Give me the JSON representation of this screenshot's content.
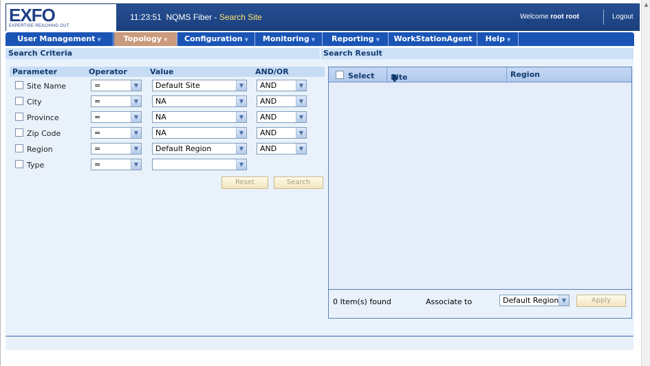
{
  "header": {
    "logo": "EXFO",
    "tagline": "EXPERTISE REACHING OUT",
    "time": "11:23:51",
    "app_name": "NQMS Fiber",
    "separator": "-",
    "page_name": "Search Site",
    "welcome_prefix": "Welcome",
    "user": "root root",
    "logout": "Logout"
  },
  "menu": {
    "items": [
      {
        "label": "User Management"
      },
      {
        "label": "Topology"
      },
      {
        "label": "Configuration"
      },
      {
        "label": "Monitoring"
      },
      {
        "label": "Reporting"
      },
      {
        "label": "WorkStationAgent"
      },
      {
        "label": "Help"
      }
    ],
    "active": "Topology",
    "colors": {
      "bar": "#1a55b6",
      "active": "#c99a7c"
    }
  },
  "criteria": {
    "title": "Search Criteria",
    "columns": [
      "Parameter",
      "Operator",
      "Value",
      "AND/OR"
    ],
    "rows": [
      {
        "param": "Site Name",
        "operator": "=",
        "value": "Default Site",
        "andor": "AND"
      },
      {
        "param": "City",
        "operator": "=",
        "value": "NA",
        "andor": "AND"
      },
      {
        "param": "Province",
        "operator": "=",
        "value": "NA",
        "andor": "AND"
      },
      {
        "param": "Zip Code",
        "operator": "=",
        "value": "NA",
        "andor": "AND"
      },
      {
        "param": "Region",
        "operator": "=",
        "value": "Default Region",
        "andor": "AND"
      },
      {
        "param": "Type",
        "operator": "=",
        "value": "",
        "andor": null
      }
    ],
    "reset_label": "Reset",
    "search_label": "Search"
  },
  "result": {
    "title": "Search Result",
    "columns": {
      "select": "Select",
      "site": "Site",
      "region": "Region"
    },
    "sort_icon": "arrow-down-icon",
    "found_text": "0 Item(s) found",
    "associate_label": "Associate to",
    "associate_value": "Default Region",
    "apply_label": "Apply"
  }
}
